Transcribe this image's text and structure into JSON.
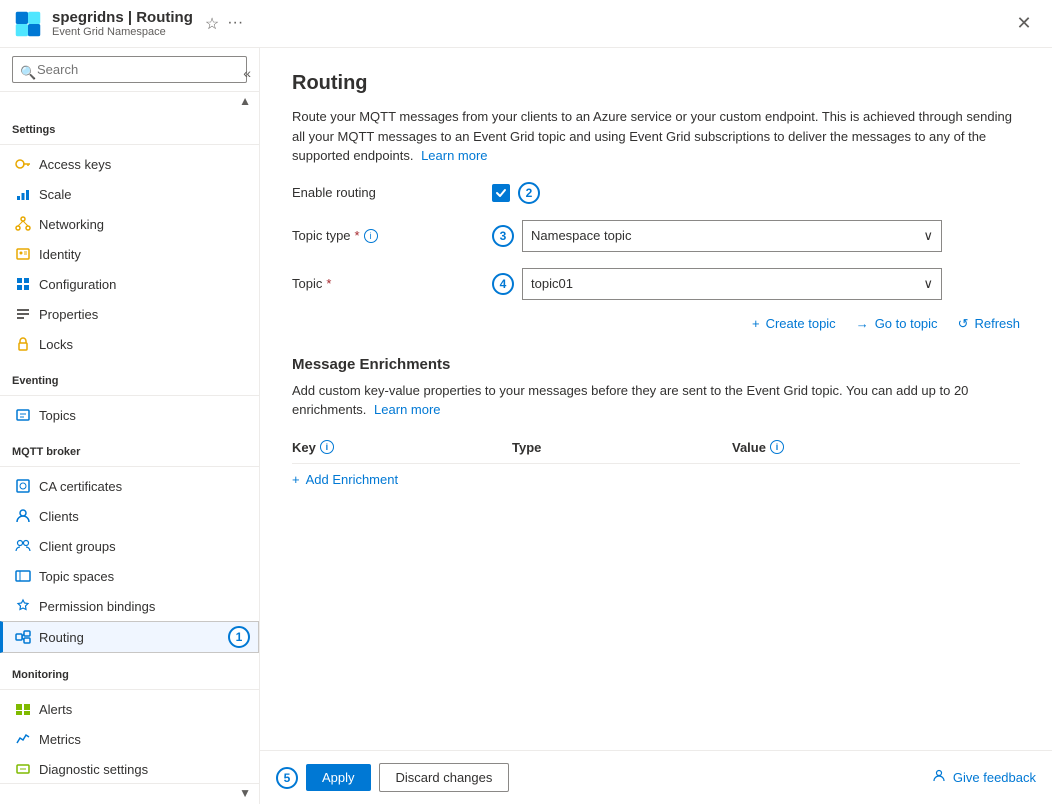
{
  "titleBar": {
    "title": "spegridns | Routing",
    "subtitle": "Event Grid Namespace",
    "bookmarkTitle": "Bookmark",
    "moreTitle": "More",
    "closeTitle": "Close"
  },
  "sidebar": {
    "searchPlaceholder": "Search",
    "sections": [
      {
        "label": "Settings",
        "items": [
          {
            "id": "access-keys",
            "label": "Access keys",
            "icon": "key"
          },
          {
            "id": "scale",
            "label": "Scale",
            "icon": "scale"
          },
          {
            "id": "networking",
            "label": "Networking",
            "icon": "network"
          },
          {
            "id": "identity",
            "label": "Identity",
            "icon": "identity"
          },
          {
            "id": "configuration",
            "label": "Configuration",
            "icon": "config"
          },
          {
            "id": "properties",
            "label": "Properties",
            "icon": "properties"
          },
          {
            "id": "locks",
            "label": "Locks",
            "icon": "lock"
          }
        ]
      },
      {
        "label": "Eventing",
        "items": [
          {
            "id": "topics",
            "label": "Topics",
            "icon": "topics"
          }
        ]
      },
      {
        "label": "MQTT broker",
        "items": [
          {
            "id": "ca-certificates",
            "label": "CA certificates",
            "icon": "ca-cert"
          },
          {
            "id": "clients",
            "label": "Clients",
            "icon": "clients"
          },
          {
            "id": "client-groups",
            "label": "Client groups",
            "icon": "client-groups"
          },
          {
            "id": "topic-spaces",
            "label": "Topic spaces",
            "icon": "topic-spaces"
          },
          {
            "id": "permission-bindings",
            "label": "Permission bindings",
            "icon": "permission"
          },
          {
            "id": "routing",
            "label": "Routing",
            "icon": "routing",
            "active": true
          }
        ]
      },
      {
        "label": "Monitoring",
        "items": [
          {
            "id": "alerts",
            "label": "Alerts",
            "icon": "alerts"
          },
          {
            "id": "metrics",
            "label": "Metrics",
            "icon": "metrics"
          },
          {
            "id": "diagnostic-settings",
            "label": "Diagnostic settings",
            "icon": "diagnostics"
          }
        ]
      }
    ]
  },
  "main": {
    "pageTitle": "Routing",
    "description": "Route your MQTT messages from your clients to an Azure service or your custom endpoint. This is achieved through sending all your MQTT messages to an Event Grid topic and using Event Grid subscriptions to deliver the messages to any of the supported endpoints.",
    "learnMoreLink": "Learn more",
    "enableRoutingLabel": "Enable routing",
    "enableRoutingChecked": true,
    "topicTypeLabel": "Topic type",
    "topicTypeRequired": true,
    "topicTypeValue": "Namespace topic",
    "topicLabel": "Topic",
    "topicRequired": true,
    "topicValue": "topic01",
    "createTopicLabel": "+ Create topic",
    "goToTopicLabel": "Go to topic",
    "refreshLabel": "Refresh",
    "messageEnrichmentsTitle": "Message Enrichments",
    "messageEnrichmentsDescription": "Add custom key-value properties to your messages before they are sent to the Event Grid topic. You can add up to 20 enrichments.",
    "messageEnrichmentsLearnMore": "Learn more",
    "tableColumns": {
      "key": "Key",
      "type": "Type",
      "value": "Value"
    },
    "addEnrichmentLabel": "+ Add Enrichment",
    "stepBadges": {
      "1": "1",
      "2": "2",
      "3": "3",
      "4": "4",
      "5": "5"
    }
  },
  "footer": {
    "applyLabel": "Apply",
    "discardLabel": "Discard changes",
    "feedbackLabel": "Give feedback"
  }
}
